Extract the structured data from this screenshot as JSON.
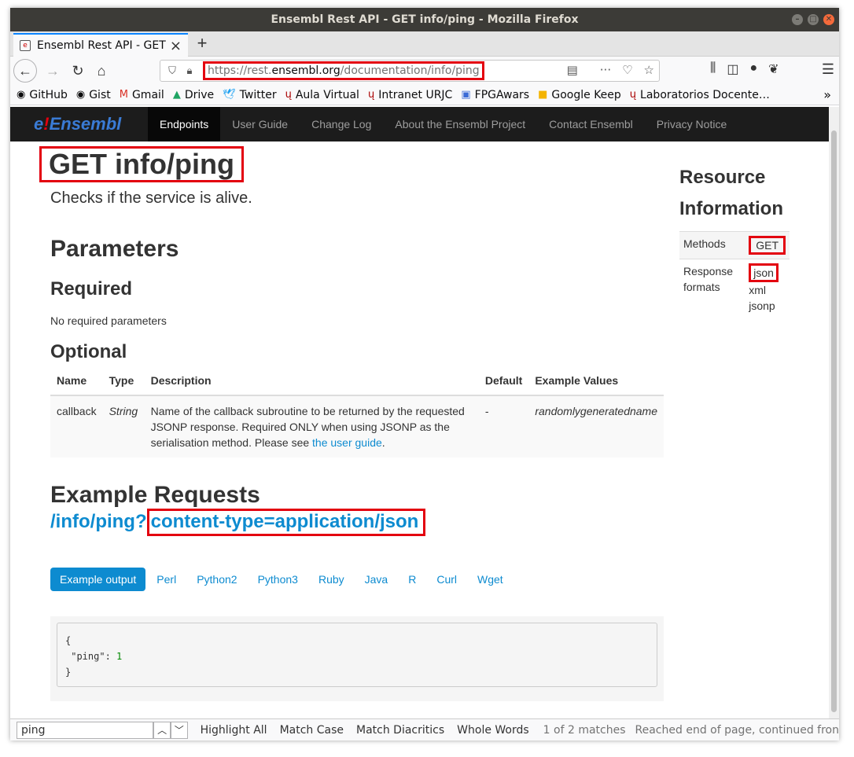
{
  "window": {
    "title": "Ensembl Rest API - GET info/ping - Mozilla Firefox"
  },
  "tab": {
    "title": "Ensembl Rest API - GET i"
  },
  "url": {
    "prefix": "https://rest.",
    "domain": "ensembl.org",
    "path": "/documentation/info/ping"
  },
  "bookmarks": [
    {
      "label": "GitHub",
      "icon": "github-icon"
    },
    {
      "label": "Gist",
      "icon": "github-icon"
    },
    {
      "label": "Gmail",
      "icon": "gmail-icon"
    },
    {
      "label": "Drive",
      "icon": "drive-icon"
    },
    {
      "label": "Twitter",
      "icon": "twitter-icon"
    },
    {
      "label": "Aula Virtual",
      "icon": "urjc-icon"
    },
    {
      "label": "Intranet URJC",
      "icon": "urjc-icon"
    },
    {
      "label": "FPGAwars",
      "icon": "chat-icon"
    },
    {
      "label": "Google Keep",
      "icon": "keep-icon"
    },
    {
      "label": "Laboratorios Docente…",
      "icon": "urjc-icon"
    }
  ],
  "nav": {
    "logo": {
      "e": "e",
      "excl": "!",
      "name": "Ensembl"
    },
    "items": [
      "Endpoints",
      "User Guide",
      "Change Log",
      "About the Ensembl Project",
      "Contact Ensembl",
      "Privacy Notice"
    ]
  },
  "page": {
    "title": "GET info/ping",
    "lead": "Checks if the service is alive.",
    "parameters": "Parameters",
    "required": "Required",
    "no_required": "No required parameters",
    "optional": "Optional",
    "table": {
      "headers": [
        "Name",
        "Type",
        "Description",
        "Default",
        "Example Values"
      ],
      "row": {
        "name": "callback",
        "type": "String",
        "description": "Name of the callback subroutine to be returned by the requested JSONP response. Required ONLY when using JSONP as the serialisation method. Please see ",
        "link": "the user guide",
        "end": ".",
        "default": "-",
        "example": "randomlygeneratedname"
      }
    },
    "example_requests": "Example Requests",
    "request_path": "/info/ping?",
    "request_query": "content-type=application/json",
    "tabs": [
      "Example output",
      "Perl",
      "Python2",
      "Python3",
      "Ruby",
      "Java",
      "R",
      "Curl",
      "Wget"
    ],
    "code": {
      "open": "{",
      "key": "\"ping\": ",
      "value": "1",
      "close": "}"
    }
  },
  "sidebar": {
    "heading1": "Resource",
    "heading2": "Information",
    "methods_label": "Methods",
    "methods_value": "GET",
    "formats_label1": "Response",
    "formats_label2": "formats",
    "formats": [
      "json",
      "xml",
      "jsonp"
    ]
  },
  "findbar": {
    "query": "ping",
    "options": [
      "Highlight All",
      "Match Case",
      "Match Diacritics",
      "Whole Words"
    ],
    "status": "1 of 2 matches",
    "status2": "Reached end of page, continued fron"
  }
}
